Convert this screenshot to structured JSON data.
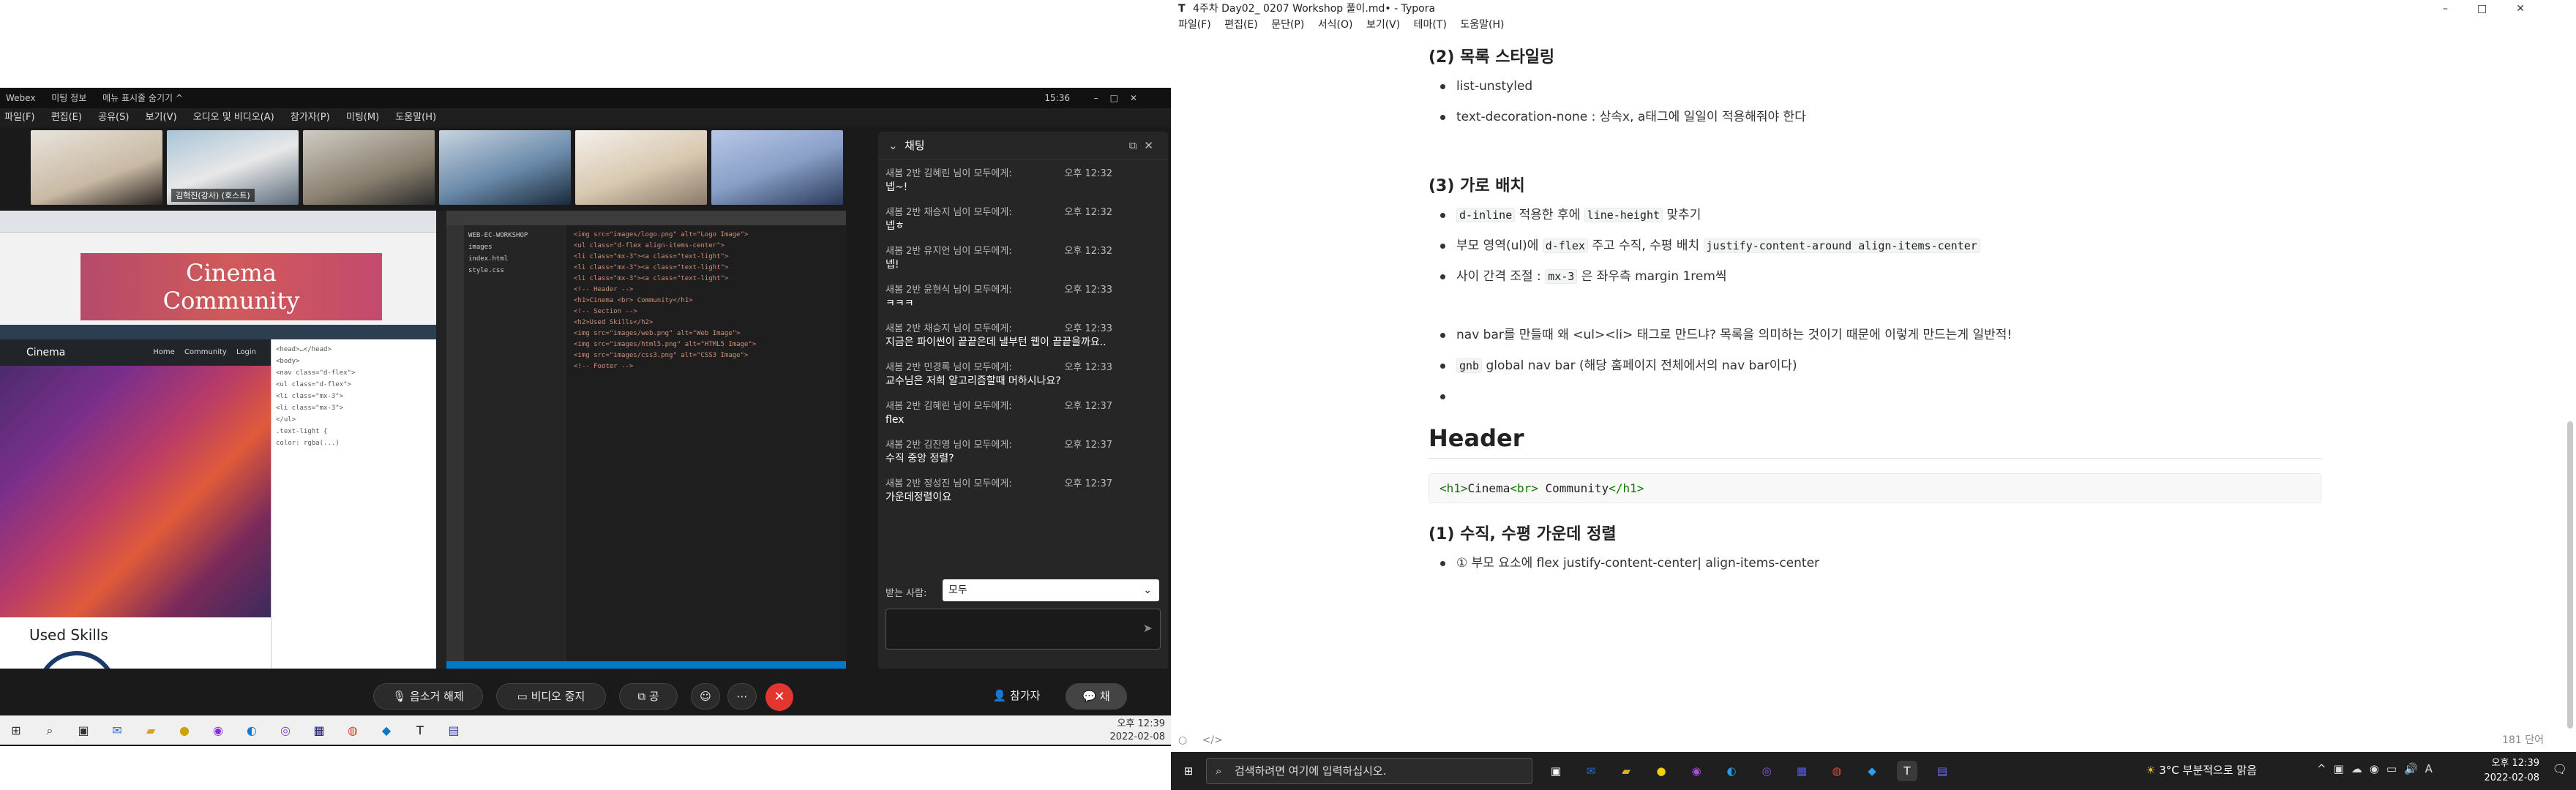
{
  "webex": {
    "title_app": "Webex",
    "title_meeting": "미팅 정보",
    "title_hide": "메뉴 표시줄 숨기기 ^",
    "clock": "15:36",
    "menu": [
      "파일(F)",
      "편집(E)",
      "공유(S)",
      "보기(V)",
      "오디오 및 비디오(A)",
      "참가자(P)",
      "미팅(M)",
      "도움말(H)"
    ],
    "host_name": "김혁진(강사) (호스트)",
    "shared": {
      "cinema_line1": "Cinema",
      "cinema_line2": "Community",
      "site_brand": "Cinema",
      "site_links": "Home Community Login",
      "site_heading": "Used Skills"
    },
    "bottom": {
      "mute": "음소거 해제",
      "video": "비디오 중지",
      "share": "공유",
      "participants": "참가자",
      "chat": "채팅"
    },
    "chat": {
      "title": "채팅",
      "messages": [
        {
          "from": "새봄 2반 김혜린 님이 모두에게:",
          "time": "오후 12:32",
          "text": "넵~!"
        },
        {
          "from": "새봄 2반 채승지 님이 모두에게:",
          "time": "오후 12:32",
          "text": "넵ㅎ"
        },
        {
          "from": "새봄 2반 유지언 님이 모두에게:",
          "time": "오후 12:32",
          "text": "넵!"
        },
        {
          "from": "새봄 2반 윤현식 님이 모두에게:",
          "time": "오후 12:33",
          "text": "ㅋㅋㅋ"
        },
        {
          "from": "새봄 2반 채승지 님이 모두에게:",
          "time": "오후 12:33",
          "text": "지금은 파이썬이 끝끝은데 낼부턴 웹이 끝끝을까요.."
        },
        {
          "from": "새봄 2반 민경록 님이 모두에게:",
          "time": "오후 12:33",
          "text": "교수님은 저희 알고리즘할때 머하시나요?"
        },
        {
          "from": "새봄 2반 김혜린 님이 모두에게:",
          "time": "오후 12:37",
          "text": "flex"
        },
        {
          "from": "새봄 2반 김진영 님이 모두에게:",
          "time": "오후 12:37",
          "text": "수직 중앙 정렬?"
        },
        {
          "from": "새봄 2반 정성진 님이 모두에게:",
          "time": "오후 12:37",
          "text": "가운데정렬이요"
        }
      ],
      "recipient_label": "받는 사람:",
      "recipient_value": "모두"
    }
  },
  "left_taskbar": {
    "time": "오후 12:39",
    "date": "2022-02-08"
  },
  "typora": {
    "title": "4주차 Day02_ 0207 Workshop 풀이.md• - Typora",
    "menu": [
      "파일(F)",
      "편집(E)",
      "문단(P)",
      "서식(O)",
      "보기(V)",
      "테마(T)",
      "도움말(H)"
    ],
    "doc": {
      "h_list": "(2) 목록 스타일링",
      "list_items": [
        "list-unstyled",
        "text-decoration-none : 상속x, a태그에 일일이 적용해줘야 한다"
      ],
      "h_horizontal": "(3) 가로 배치",
      "hz1_code": "d-inline",
      "hz1_text_a": " 적용한 후에 ",
      "hz1_code2": "line-height",
      "hz1_text_b": " 맞추기",
      "hz2_text_a": "부모 영역(ul)에 ",
      "hz2_code": "d-flex",
      "hz2_text_b": " 주고 수직, 수평 배치 ",
      "hz2_code2": "justify-content-around align-items-center",
      "hz3_text_a": "사이 간격 조절 : ",
      "hz3_code": "mx-3",
      "hz3_text_b": " 은 좌우측 margin 1rem씩",
      "nav1": "nav bar를 만들때 왜 <ul><li> 태그로 만드냐? 목록을 의미하는 것이기 때문에 이렇게 만드는게 일반적!",
      "nav2_code": "gnb",
      "nav2_text": " global nav bar (해당 홈페이지 전체에서의 nav bar이다)",
      "h_header": "Header",
      "code_open": "<h1>",
      "code_text1": "Cinema",
      "code_br": "<br>",
      "code_text2": " Community",
      "code_close": "</h1>",
      "h_center": "(1) 수직, 수평 가운데 정렬",
      "center_item": "① 부모 요소에 flex  justify-content-center| align-items-center"
    },
    "word_count": "181 단어"
  },
  "right_taskbar": {
    "search_placeholder": "검색하려면 여기에 입력하십시오.",
    "weather": "3°C  부분적으로 맑음",
    "time": "오후 12:39",
    "date": "2022-02-08"
  }
}
